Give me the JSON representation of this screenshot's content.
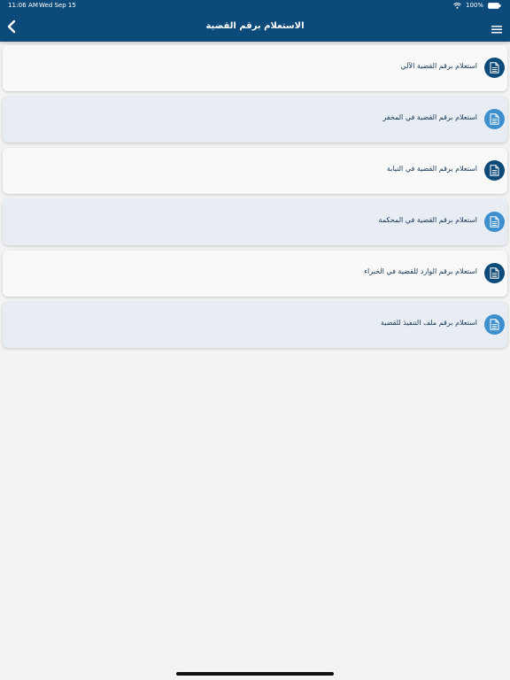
{
  "status_bar": {
    "time": "11:06 AM",
    "date": "Wed Sep 15",
    "battery": "100%"
  },
  "header": {
    "title": "الاستعلام برقم القضية",
    "background_color": "#0c4a79"
  },
  "list": {
    "items": [
      {
        "label": "استعلام برقم القضية الآلي",
        "icon": "document-icon"
      },
      {
        "label": "استعلام برقم القضية في المخفر",
        "icon": "document-icon"
      },
      {
        "label": "استعلام برقم القضية في النيابة",
        "icon": "document-icon"
      },
      {
        "label": "استعلام برقم القضية في المحكمة",
        "icon": "document-icon"
      },
      {
        "label": "استعلام برقم الوارد للقضية في الخبراء",
        "icon": "document-icon"
      },
      {
        "label": "استعلام برقم ملف التنفيذ للقضية",
        "icon": "document-icon"
      }
    ]
  },
  "colors": {
    "primary": "#0c4a79",
    "secondary": "#3f8fcf",
    "card_light": "#f9f9f9",
    "card_alt": "#e8edf3"
  }
}
